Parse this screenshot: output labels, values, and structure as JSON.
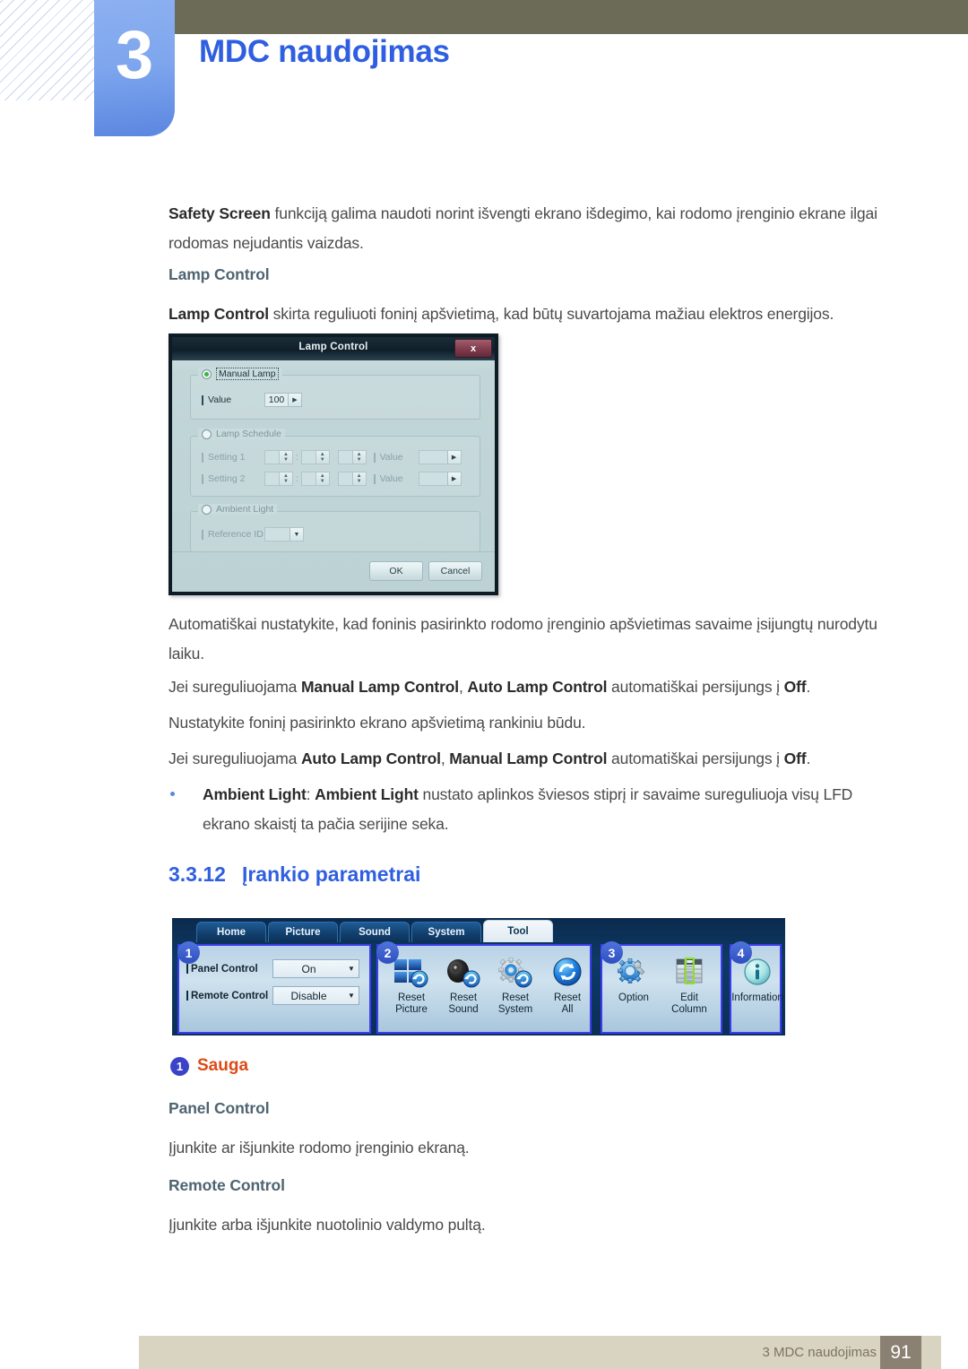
{
  "header": {
    "chapter_number": "3",
    "chapter_title": "MDC naudojimas"
  },
  "content": {
    "intro_bold": "Safety Screen",
    "intro_rest": " funkciją galima naudoti norint išvengti ekrano išdegimo, kai rodomo įrenginio ekrane ilgai rodomas nejudantis vaizdas.",
    "lamp_control_heading": "Lamp Control",
    "lamp_desc_bold": "Lamp Control",
    "lamp_desc_rest": " skirta reguliuoti foninį apšvietimą, kad būtų suvartojama mažiau elektros energijos.",
    "para_auto": "Automatiškai nustatykite, kad foninis pasirinkto rodomo įrenginio apšvietimas savaime įsijungtų nurodytu laiku.",
    "para_manual_switch_pre": "Jei sureguliuojama ",
    "para_manual_switch_b1": "Manual Lamp Control",
    "para_manual_switch_mid": ", ",
    "para_manual_switch_b2": "Auto Lamp Control",
    "para_manual_switch_post": " automatiškai persijungs į ",
    "para_manual_switch_b3": "Off",
    "para_manual_switch_end": ".",
    "para_set_manual": "Nustatykite foninį pasirinkto ekrano apšvietimą rankiniu būdu.",
    "para_auto_switch_pre": "Jei sureguliuojama ",
    "para_auto_switch_b1": "Auto Lamp Control",
    "para_auto_switch_mid": ", ",
    "para_auto_switch_b2": "Manual Lamp Control",
    "para_auto_switch_post": " automatiškai persijungs į ",
    "para_auto_switch_b3": "Off",
    "para_auto_switch_end": ".",
    "bullet_ambient_b1": "Ambient Light",
    "bullet_ambient_sep": ": ",
    "bullet_ambient_b2": "Ambient Light",
    "bullet_ambient_rest": " nustato aplinkos šviesos stiprį ir savaime sureguliuoja visų LFD ekrano skaistį ta pačia serijine seka.",
    "section_number": "3.3.12",
    "section_title": "Įrankio parametrai",
    "sauga_badge": "1",
    "sauga_title": "Sauga",
    "panel_control_heading": "Panel Control",
    "panel_control_desc": "Įjunkite ar išjunkite rodomo įrenginio ekraną.",
    "remote_control_heading": "Remote Control",
    "remote_control_desc": "Įjunkite arba išjunkite nuotolinio valdymo pultą."
  },
  "lamp_dialog": {
    "title": "Lamp Control",
    "close_label": "x",
    "manual_lamp_legend": "Manual Lamp",
    "value_label": "Value",
    "value_amount": "100",
    "lamp_schedule_legend": "Lamp Schedule",
    "setting1_label": "Setting 1",
    "setting2_label": "Setting 2",
    "schedule_value_label": "Value",
    "ambient_light_legend": "Ambient Light",
    "reference_id_label": "Reference ID",
    "ok_label": "OK",
    "cancel_label": "Cancel"
  },
  "tool_bar": {
    "tabs": [
      {
        "label": "Home",
        "active": false
      },
      {
        "label": "Picture",
        "active": false
      },
      {
        "label": "Sound",
        "active": false
      },
      {
        "label": "System",
        "active": false
      },
      {
        "label": "Tool",
        "active": true
      }
    ],
    "badges": [
      "1",
      "2",
      "3",
      "4"
    ],
    "group1": {
      "panel_control_label": "Panel Control",
      "panel_control_value": "On",
      "remote_control_label": "Remote Control",
      "remote_control_value": "Disable"
    },
    "group2": [
      {
        "line1": "Reset",
        "line2": "Picture",
        "icon": "reset-picture-icon"
      },
      {
        "line1": "Reset",
        "line2": "Sound",
        "icon": "reset-sound-icon"
      },
      {
        "line1": "Reset",
        "line2": "System",
        "icon": "reset-system-icon"
      },
      {
        "line1": "Reset",
        "line2": "All",
        "icon": "reset-all-icon"
      }
    ],
    "group3": [
      {
        "line1": "Option",
        "line2": "",
        "icon": "option-gear-icon"
      },
      {
        "line1": "Edit",
        "line2": "Column",
        "icon": "edit-column-icon"
      }
    ],
    "group4": [
      {
        "line1": "Information",
        "line2": "",
        "icon": "information-icon"
      }
    ]
  },
  "footer": {
    "text": "3 MDC naudojimas",
    "page": "91"
  },
  "colors": {
    "accent_blue": "#2f5fe0",
    "header_brown": "#6c6b57",
    "footer_bar": "#d9d3c2",
    "footer_page_box": "#8b8172",
    "orange": "#dd4a16",
    "badge_blue": "#3b44c8",
    "subhead": "#4e6471"
  }
}
